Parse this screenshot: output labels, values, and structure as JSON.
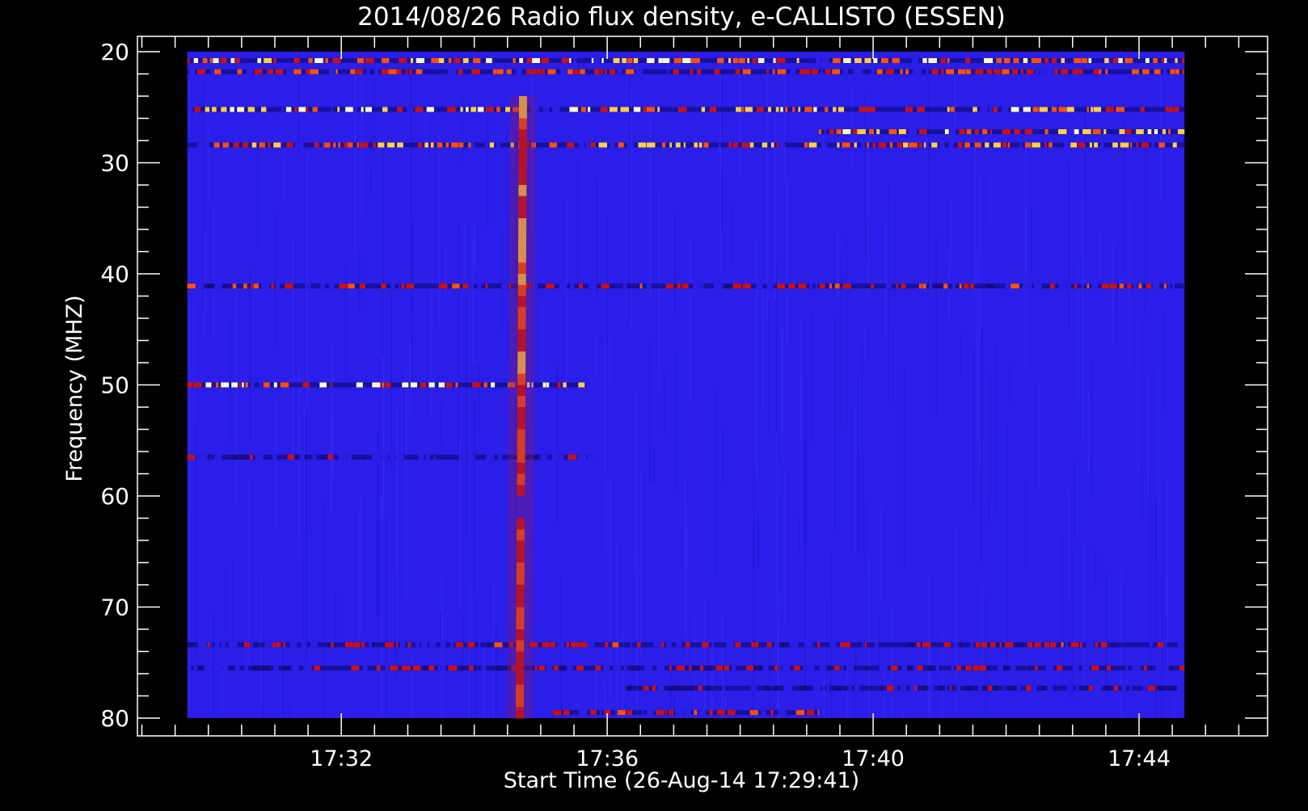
{
  "chart_data": {
    "type": "heatmap",
    "title": "2014/08/26  Radio flux density, e-CALLISTO (ESSEN)",
    "xlabel": "Start Time (26-Aug-14 17:29:41)",
    "ylabel": "Frequency (MHZ)",
    "x_tick_labels": [
      "17:32",
      "17:36",
      "17:40",
      "17:44"
    ],
    "x_tick_minutes": [
      2.3167,
      6.3167,
      10.3167,
      14.3167
    ],
    "xlim_minutes": [
      -0.75,
      16.25
    ],
    "data_x_range_minutes": [
      0.0,
      15.0
    ],
    "y_tick_labels": [
      "20",
      "30",
      "40",
      "50",
      "60",
      "70",
      "80"
    ],
    "y_tick_values": [
      20,
      30,
      40,
      50,
      60,
      70,
      80
    ],
    "ylim": [
      80,
      20
    ],
    "y_reversed": true,
    "grid": false,
    "background_color": "#2a1ee8",
    "colormap": [
      "#000000",
      "#1a0a80",
      "#2a1ee8",
      "#cc1010",
      "#ff5000",
      "#ffd040",
      "#ffffc0"
    ],
    "features": [
      {
        "kind": "interference-band",
        "freq": 20.8,
        "t_start": 0.0,
        "t_end": 15.0,
        "intensity": 0.85
      },
      {
        "kind": "interference-band",
        "freq": 21.8,
        "t_start": 0.0,
        "t_end": 15.0,
        "intensity": 0.55
      },
      {
        "kind": "interference-band",
        "freq": 25.2,
        "t_start": 0.0,
        "t_end": 15.0,
        "intensity": 0.75
      },
      {
        "kind": "interference-band",
        "freq": 27.2,
        "t_start": 9.5,
        "t_end": 15.0,
        "intensity": 0.7
      },
      {
        "kind": "interference-band",
        "freq": 28.4,
        "t_start": 0.0,
        "t_end": 15.0,
        "intensity": 0.65
      },
      {
        "kind": "interference-band",
        "freq": 41.1,
        "t_start": 0.0,
        "t_end": 15.0,
        "intensity": 0.5
      },
      {
        "kind": "interference-band",
        "freq": 50.0,
        "t_start": 0.0,
        "t_end": 6.0,
        "intensity": 0.9
      },
      {
        "kind": "interference-band",
        "freq": 56.5,
        "t_start": 0.0,
        "t_end": 6.1,
        "intensity": 0.35
      },
      {
        "kind": "interference-band",
        "freq": 73.4,
        "t_start": 0.0,
        "t_end": 15.0,
        "intensity": 0.45
      },
      {
        "kind": "interference-band",
        "freq": 75.5,
        "t_start": 0.0,
        "t_end": 15.0,
        "intensity": 0.4
      },
      {
        "kind": "interference-band",
        "freq": 77.3,
        "t_start": 6.6,
        "t_end": 15.0,
        "intensity": 0.35
      },
      {
        "kind": "interference-band",
        "freq": 79.5,
        "t_start": 5.5,
        "t_end": 9.5,
        "intensity": 0.5
      },
      {
        "kind": "burst",
        "freq_start": 24,
        "freq_end": 80,
        "t_center": 5.0,
        "t_width": 0.12,
        "drift": 0.05,
        "intensity": 0.8
      }
    ]
  }
}
